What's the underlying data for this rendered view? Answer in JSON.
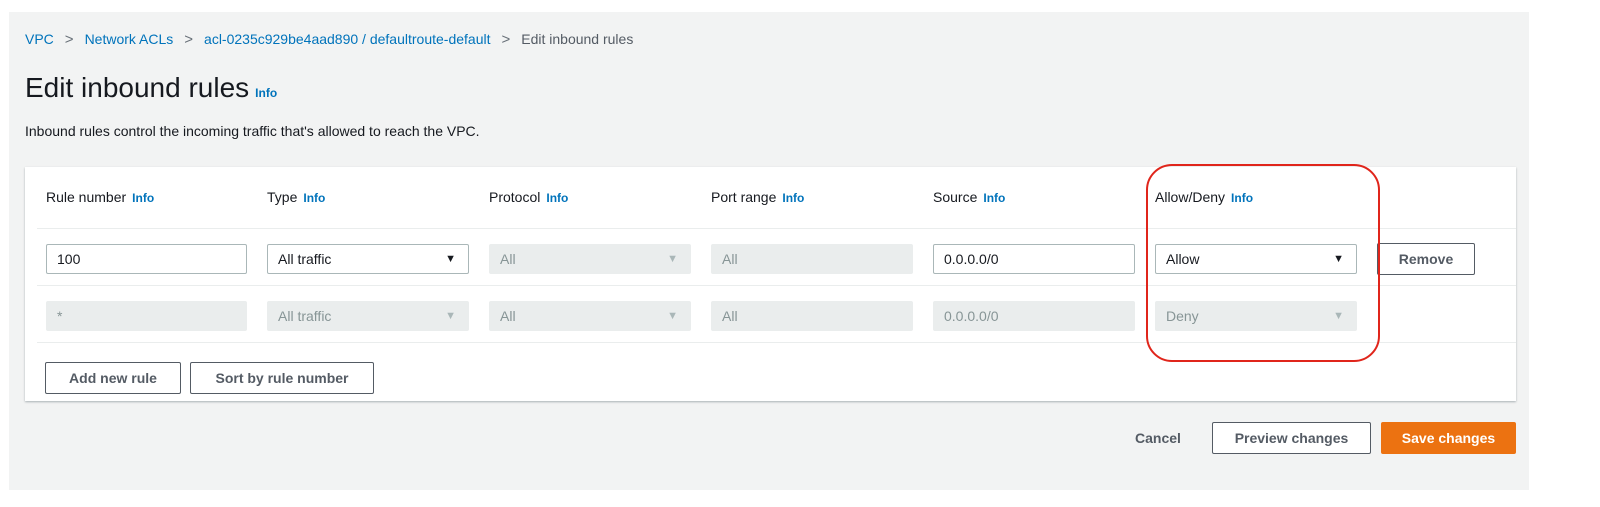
{
  "breadcrumb": {
    "items": [
      "VPC",
      "Network ACLs",
      "acl-0235c929be4aad890 / defaultroute-default"
    ],
    "current": "Edit inbound rules",
    "separator": ">"
  },
  "page": {
    "title": "Edit inbound rules",
    "info_label": "Info",
    "description": "Inbound rules control the incoming traffic that's allowed to reach the VPC."
  },
  "table": {
    "columns": [
      "Rule number",
      "Type",
      "Protocol",
      "Port range",
      "Source",
      "Allow/Deny"
    ],
    "info_label": "Info",
    "rows": [
      {
        "rule_number": "100",
        "type": "All traffic",
        "protocol": "All",
        "port_range": "All",
        "source": "0.0.0.0/0",
        "action": "Allow",
        "remove_label": "Remove"
      },
      {
        "rule_number": "*",
        "type": "All traffic",
        "protocol": "All",
        "port_range": "All",
        "source": "0.0.0.0/0",
        "action": "Deny"
      }
    ],
    "add_rule_label": "Add new rule",
    "sort_label": "Sort by rule number"
  },
  "footer": {
    "cancel_label": "Cancel",
    "preview_label": "Preview changes",
    "save_label": "Save changes"
  },
  "colors": {
    "link": "#0073bb",
    "primary": "#ec7211",
    "highlight": "#e0251b"
  },
  "icons": {
    "breadcrumb_separator": "chevron-right-icon",
    "dropdown": "caret-down-icon"
  }
}
